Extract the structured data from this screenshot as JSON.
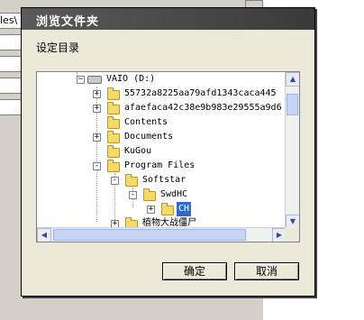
{
  "background": {
    "path_fragment": "les\\",
    "fields": [
      "",
      "",
      "",
      "",
      ""
    ]
  },
  "dialog": {
    "title": "浏览文件夹",
    "caption": "设定目录",
    "tree": {
      "drive": "VAIO (D:)",
      "items": [
        {
          "label": "55732a8225aa79afd1343caca445",
          "expander": "+"
        },
        {
          "label": "afaefaca42c38e9b983e29555a9d6",
          "expander": "+"
        },
        {
          "label": "Contents",
          "expander": ""
        },
        {
          "label": "Documents",
          "expander": "+"
        },
        {
          "label": "KuGou",
          "expander": ""
        },
        {
          "label": "Program Files",
          "expander": "-"
        },
        {
          "label": "Softstar",
          "expander": "-"
        },
        {
          "label": "SwdHC",
          "expander": "-"
        },
        {
          "label": "CH",
          "expander": "+",
          "selected": true
        },
        {
          "label": "植物大战僵尸",
          "expander": "+"
        }
      ]
    },
    "buttons": {
      "ok": "确定",
      "cancel": "取消"
    }
  }
}
